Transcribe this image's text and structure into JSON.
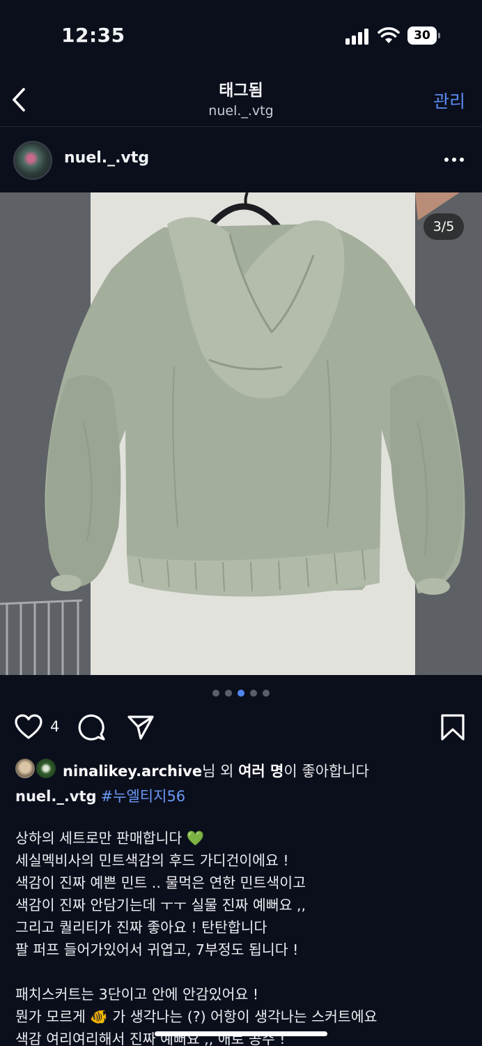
{
  "status_bar": {
    "time": "12:35",
    "battery": "30"
  },
  "nav": {
    "title": "태그됨",
    "subtitle": "nuel._.vtg",
    "manage": "관리"
  },
  "post": {
    "username": "nuel._.vtg",
    "counter": "3/5",
    "dots": {
      "count": 5,
      "active_index": 2
    }
  },
  "actions": {
    "like_count": "4"
  },
  "liked_by": {
    "name": "ninalikey.archive",
    "rest_1": "님 외 ",
    "bold_2": "여러 명",
    "rest_2": "이 좋아합니다"
  },
  "caption": {
    "user": "nuel._.vtg",
    "hashtag": "#누엘티지56",
    "lines": [
      "상하의 세트로만 판매합니다 💚",
      "세실멕비사의 민트색감의 후드 가디건이에요 !",
      "색감이 진짜 예쁜 민트 .. 물먹은 연한 민트색이고",
      "색감이 진짜 안담기는데 ㅜㅜ 실물 진짜 예뻐요 ,,",
      "그리고 퀄리티가 진짜 좋아요 ! 탄탄합니다",
      "팔 퍼프 들어가있어서 귀엽고, 7부정도 됩니다 !",
      "",
      "패치스커트는 3단이고 안에 안감있어요 !",
      "뭔가 모르게 🐠 가 생각나는 (?) 어항이 생각나는 스커트에요",
      "색감 여리여리해서 진짜 예뻐요 ,, 애로 공주 !"
    ]
  },
  "colors": {
    "background": "#0b0f1c",
    "accent": "#5b8cf2",
    "hashtag": "#6a98f5",
    "jacket": "#a3ad9b"
  }
}
